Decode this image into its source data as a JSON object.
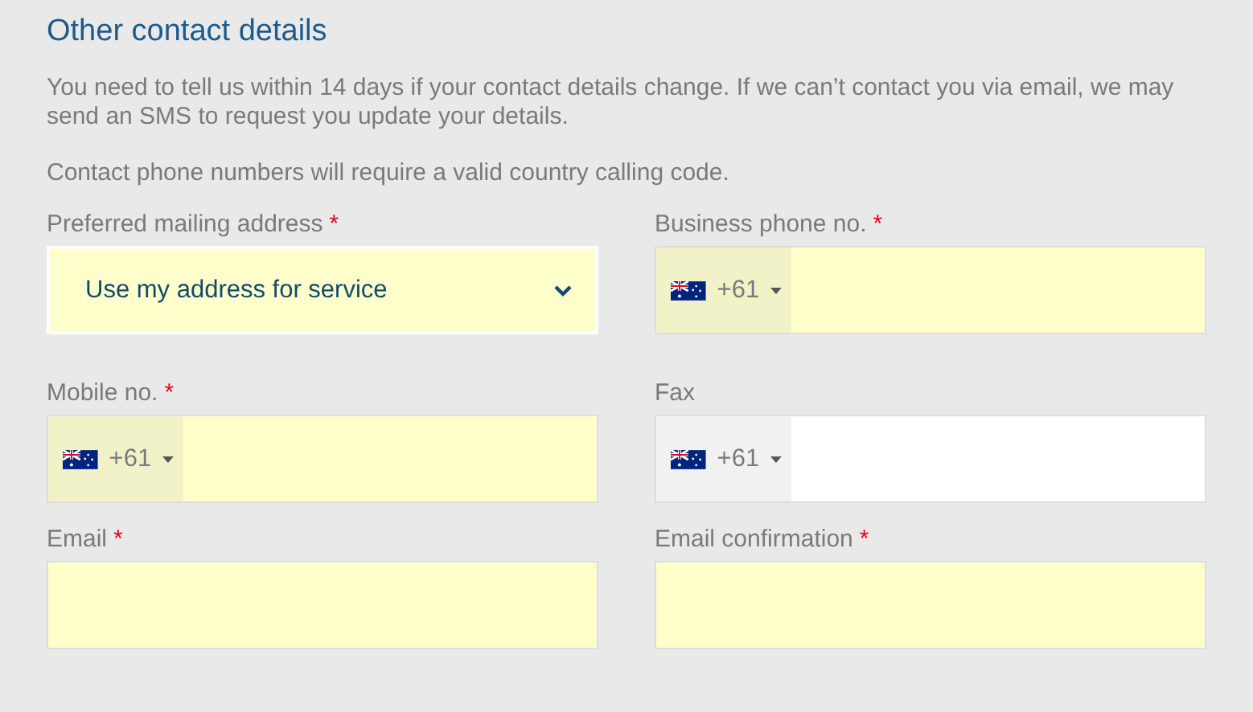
{
  "heading": "Other contact details",
  "paragraphs": [
    "You need to tell us within 14 days if your contact details change. If we can’t contact you via email, we may send an SMS to request you update your details.",
    "Contact phone numbers will require a valid country calling code."
  ],
  "rows": [
    [
      {
        "kind": "select",
        "label": "Preferred mailing address",
        "mark": "*",
        "required": true,
        "value": "Use my address for service"
      },
      {
        "kind": "phone",
        "label": "Business phone no.",
        "mark": "*",
        "required": true,
        "code": "+61"
      }
    ],
    [
      {
        "kind": "phone",
        "label": "Mobile no.",
        "mark": "*",
        "required": true,
        "code": "+61"
      },
      {
        "kind": "phone",
        "label": "Fax",
        "required": false,
        "code": "+61"
      }
    ],
    [
      {
        "kind": "text",
        "label": "Email",
        "mark": "*",
        "required": true
      },
      {
        "kind": "text",
        "label": "Email confirmation",
        "mark": "*",
        "required": true
      }
    ]
  ]
}
